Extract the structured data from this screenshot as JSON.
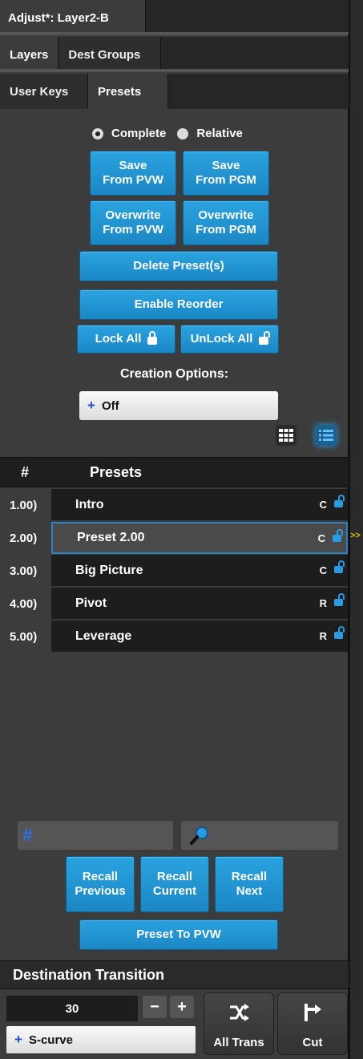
{
  "window": {
    "title": "Adjust*: Layer2-B"
  },
  "tabs_row1": [
    {
      "label": "Layers",
      "active": true
    },
    {
      "label": "Dest Groups",
      "active": false
    }
  ],
  "tabs_row2": [
    {
      "label": "User Keys",
      "active": false
    },
    {
      "label": "Presets",
      "active": true
    }
  ],
  "mode": {
    "complete_label": "Complete",
    "relative_label": "Relative",
    "selected": "Complete"
  },
  "buttons": {
    "save_pvw": "Save\nFrom PVW",
    "save_pgm": "Save\nFrom PGM",
    "overwrite_pvw": "Overwrite\nFrom PVW",
    "overwrite_pgm": "Overwrite\nFrom PGM",
    "delete": "Delete Preset(s)",
    "enable_reorder": "Enable Reorder",
    "lock_all": "Lock All",
    "unlock_all": "UnLock All"
  },
  "creation": {
    "label": "Creation Options:",
    "value": "Off",
    "plus": "+"
  },
  "list": {
    "col_num": "#",
    "col_name": "Presets",
    "items": [
      {
        "num": "1.00)",
        "name": "Intro",
        "mode": "C"
      },
      {
        "num": "2.00)",
        "name": "Preset 2.00",
        "mode": "C",
        "selected": true
      },
      {
        "num": "3.00)",
        "name": "Big Picture",
        "mode": "C"
      },
      {
        "num": "4.00)",
        "name": "Pivot",
        "mode": "R"
      },
      {
        "num": "5.00)",
        "name": "Leverage",
        "mode": "R"
      }
    ],
    "marker": ">>"
  },
  "search": {
    "hash": "#"
  },
  "recall": {
    "previous": "Recall\nPrevious",
    "current": "Recall\nCurrent",
    "next": "Recall\nNext",
    "to_pvw": "Preset To PVW"
  },
  "transition": {
    "header": "Destination Transition",
    "rate": "30",
    "minus": "−",
    "plus": "+",
    "curve": "S-curve",
    "curve_plus": "+",
    "all_trans": "All Trans",
    "cut": "Cut"
  },
  "colors": {
    "accent": "#1e90d6",
    "panel": "#3c3c3c",
    "dark": "#1d1d1d"
  }
}
